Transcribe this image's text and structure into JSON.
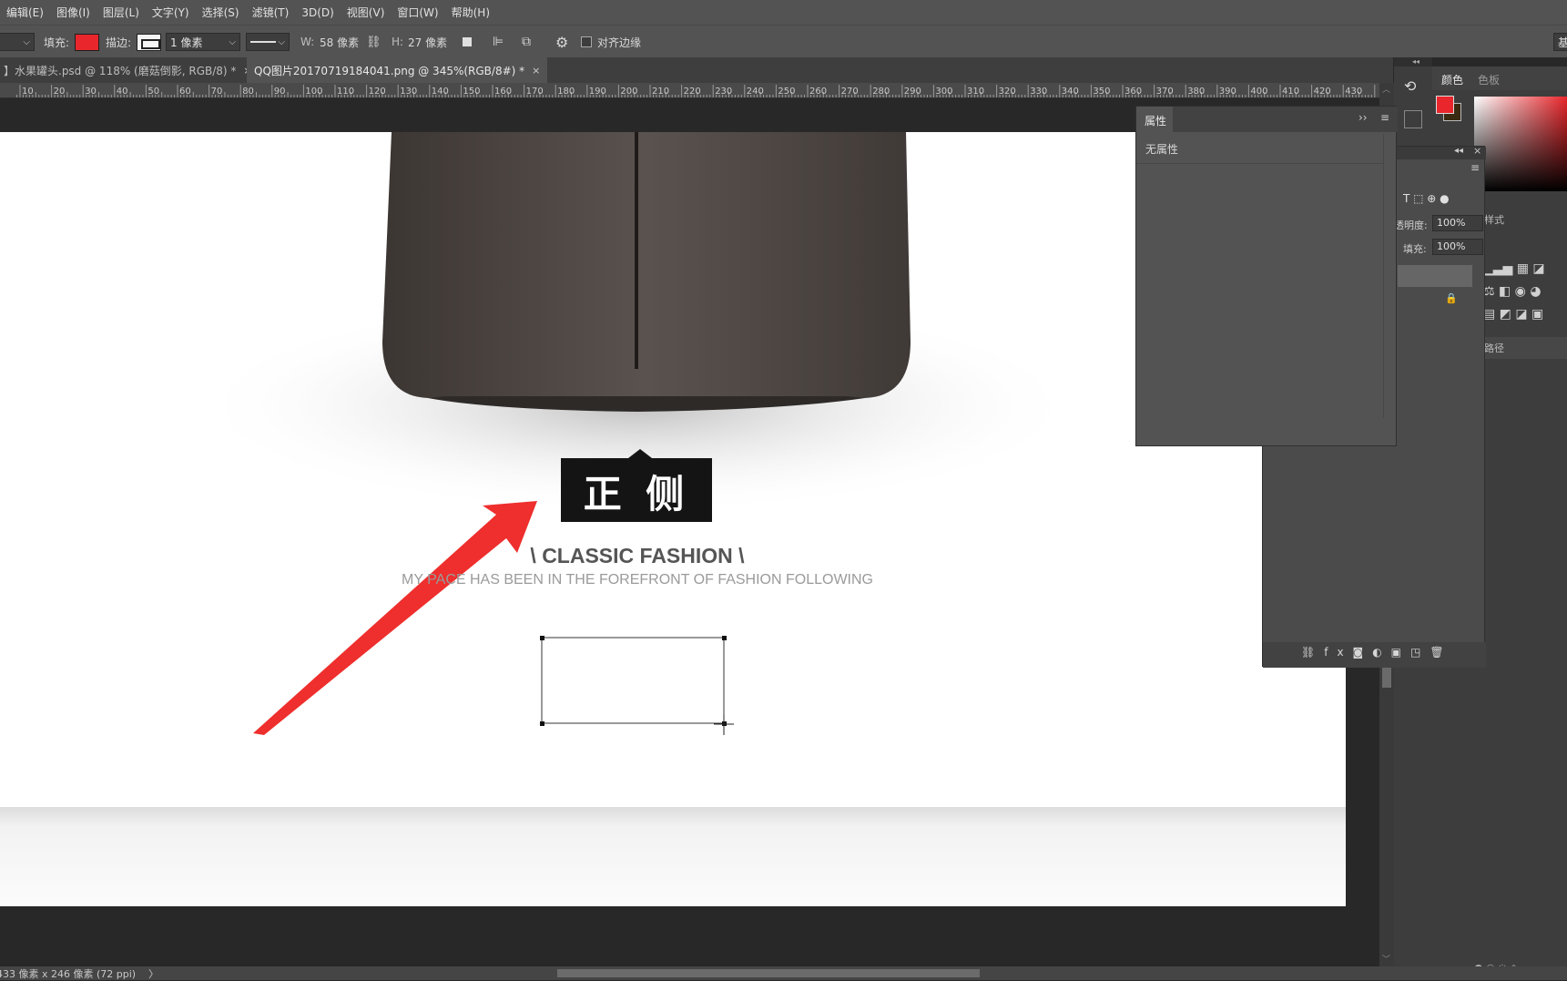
{
  "menu": [
    "编辑(E)",
    "图像(I)",
    "图层(L)",
    "文字(Y)",
    "选择(S)",
    "滤镜(T)",
    "3D(D)",
    "视图(V)",
    "窗口(W)",
    "帮助(H)"
  ],
  "options": {
    "fill_label": "填充:",
    "fill_color": "#e8262b",
    "stroke_label": "描边:",
    "stroke_width": "1 像素",
    "w_label": "W:",
    "w_value": "58 像素",
    "h_label": "H:",
    "h_value": "27 像素",
    "align_edges": "对齐边缘",
    "right_cut": "基"
  },
  "tabs": [
    {
      "label": "】水果罐头.psd @ 118% (磨菇倒影, RGB/8) *",
      "close": "×"
    },
    {
      "label": "QQ图片20170719184041.png @ 345%(RGB/8#) *",
      "close": "×"
    }
  ],
  "ruler_ticks": [
    "10",
    "20",
    "30",
    "40",
    "50",
    "60",
    "70",
    "80",
    "90",
    "100",
    "110",
    "120",
    "130",
    "140",
    "150",
    "160",
    "170",
    "180",
    "190",
    "200",
    "210",
    "220",
    "230",
    "240",
    "250",
    "260",
    "270",
    "280",
    "290",
    "300",
    "310",
    "320",
    "330",
    "340",
    "350",
    "360",
    "370",
    "380",
    "390",
    "400",
    "410",
    "420",
    "430"
  ],
  "canvas": {
    "badge_text": "正 侧",
    "headline": "\\ CLASSIC FASHION \\",
    "subline": "MY PACE HAS BEEN IN THE FOREFRONT OF FASHION FOLLOWING"
  },
  "properties": {
    "tab": "属性",
    "empty": "无属性"
  },
  "layers": {
    "opacity_label": "透明度:",
    "opacity_value": "100%",
    "fill_label": "填充:",
    "fill_value": "100%"
  },
  "color_panel": {
    "tabs": [
      "颜色",
      "色板"
    ],
    "fg": "#e8262b",
    "bg": "#3b2a12",
    "styles_tab": "样式",
    "paths_tab": "路径"
  },
  "status": {
    "doc_info": "433 像素 x 246 像素 (72 ppi)",
    "arrow": "〉"
  }
}
